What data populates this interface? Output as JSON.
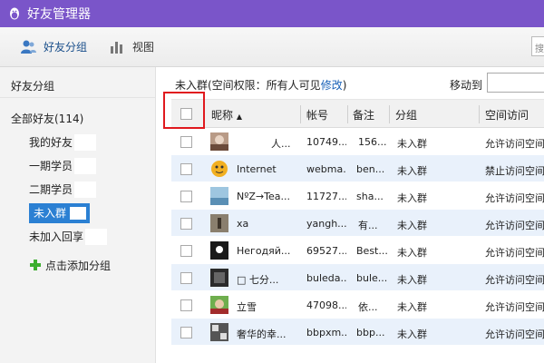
{
  "window": {
    "title": "好友管理器",
    "accent": "#7a55c9"
  },
  "toolbar": {
    "friend_groups": "好友分组",
    "view": "视图",
    "search_placeholder": "搜"
  },
  "sidebar": {
    "header": "好友分组",
    "all_friends": "全部好友(114)",
    "items": [
      {
        "label": "我的好友",
        "active": false
      },
      {
        "label": "一期学员",
        "active": false
      },
      {
        "label": "二期学员",
        "active": false
      },
      {
        "label": "未入群",
        "active": true
      },
      {
        "label": "未加入回享",
        "active": false
      }
    ],
    "add_group": "点击添加分组"
  },
  "info": {
    "text": "未入群(空间权限：所有人可见",
    "link": "修改",
    "close": ")"
  },
  "move_to": {
    "label": "移动到"
  },
  "columns": {
    "nick": "昵称",
    "sort_arrow": "▲",
    "account": "帐号",
    "remark": "备注",
    "group": "分组",
    "space": "空间访问"
  },
  "rows": [
    {
      "nick": "人...",
      "account": "10749...",
      "remark": "156...",
      "group": "未入群",
      "space": "允许访问空间"
    },
    {
      "nick": "Internet",
      "account": "webma...",
      "remark": "ben...",
      "group": "未入群",
      "space": "禁止访问空间"
    },
    {
      "nick": "NºZ→Tea...",
      "account": "11727...",
      "remark": "sha...",
      "group": "未入群",
      "space": "允许访问空间"
    },
    {
      "nick": "xa",
      "account": "yangh...",
      "remark": "有...",
      "group": "未入群",
      "space": "允许访问空间"
    },
    {
      "nick": "Негодяй...",
      "account": "69527...",
      "remark": "Best...",
      "group": "未入群",
      "space": "允许访问空间"
    },
    {
      "nick": "□ 七分...",
      "account": "buleda...",
      "remark": "bule...",
      "group": "未入群",
      "space": "允许访问空间"
    },
    {
      "nick": "立雪",
      "account": "47098...",
      "remark": "依...",
      "group": "未入群",
      "space": "允许访问空间"
    },
    {
      "nick": "奢华的幸...",
      "account": "bbpxm...",
      "remark": "bbp...",
      "group": "未入群",
      "space": "允许访问空间"
    }
  ]
}
